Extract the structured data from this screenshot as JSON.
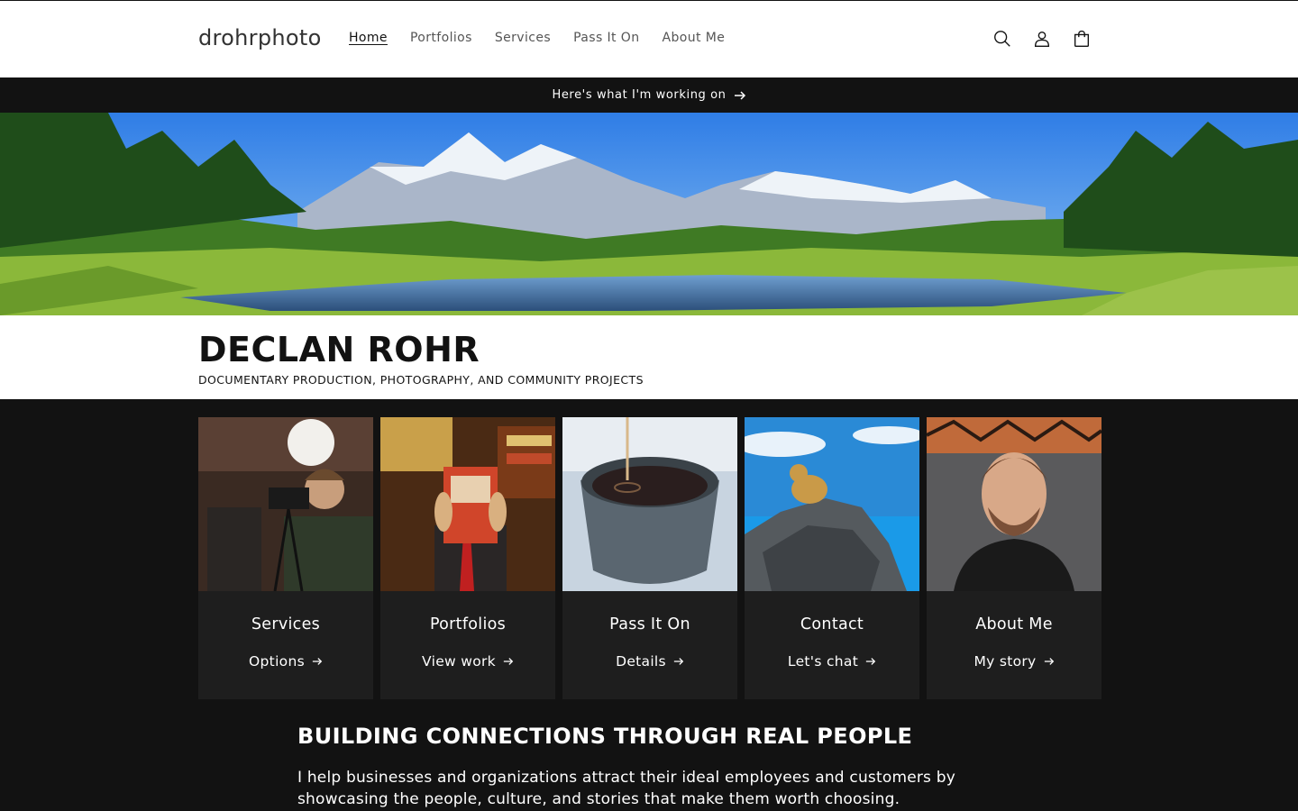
{
  "header": {
    "logo": "drohrphoto",
    "nav": [
      {
        "label": "Home",
        "active": true
      },
      {
        "label": "Portfolios",
        "active": false
      },
      {
        "label": "Services",
        "active": false
      },
      {
        "label": "Pass It On",
        "active": false
      },
      {
        "label": "About Me",
        "active": false
      }
    ],
    "icons": [
      "search-icon",
      "account-icon",
      "cart-icon"
    ]
  },
  "announcement": {
    "text": "Here's what I'm working on",
    "icon": "arrow-right-icon"
  },
  "hero": {
    "title": "DECLAN ROHR",
    "subtitle": "DOCUMENTARY PRODUCTION, PHOTOGRAPHY, AND COMMUNITY PROJECTS"
  },
  "cards": [
    {
      "title": "Services",
      "link": "Options"
    },
    {
      "title": "Portfolios",
      "link": "View work"
    },
    {
      "title": "Pass It On",
      "link": "Details"
    },
    {
      "title": "Contact",
      "link": "Let's chat"
    },
    {
      "title": "About Me",
      "link": "My story"
    }
  ],
  "intro": {
    "heading": "BUILDING CONNECTIONS THROUGH REAL PEOPLE",
    "text": "I help businesses and organizations attract their ideal employees and customers by showcasing the people, culture, and stories that make them worth choosing."
  },
  "colors": {
    "dark": "#121212",
    "card": "#1e1e1e",
    "white": "#ffffff"
  }
}
